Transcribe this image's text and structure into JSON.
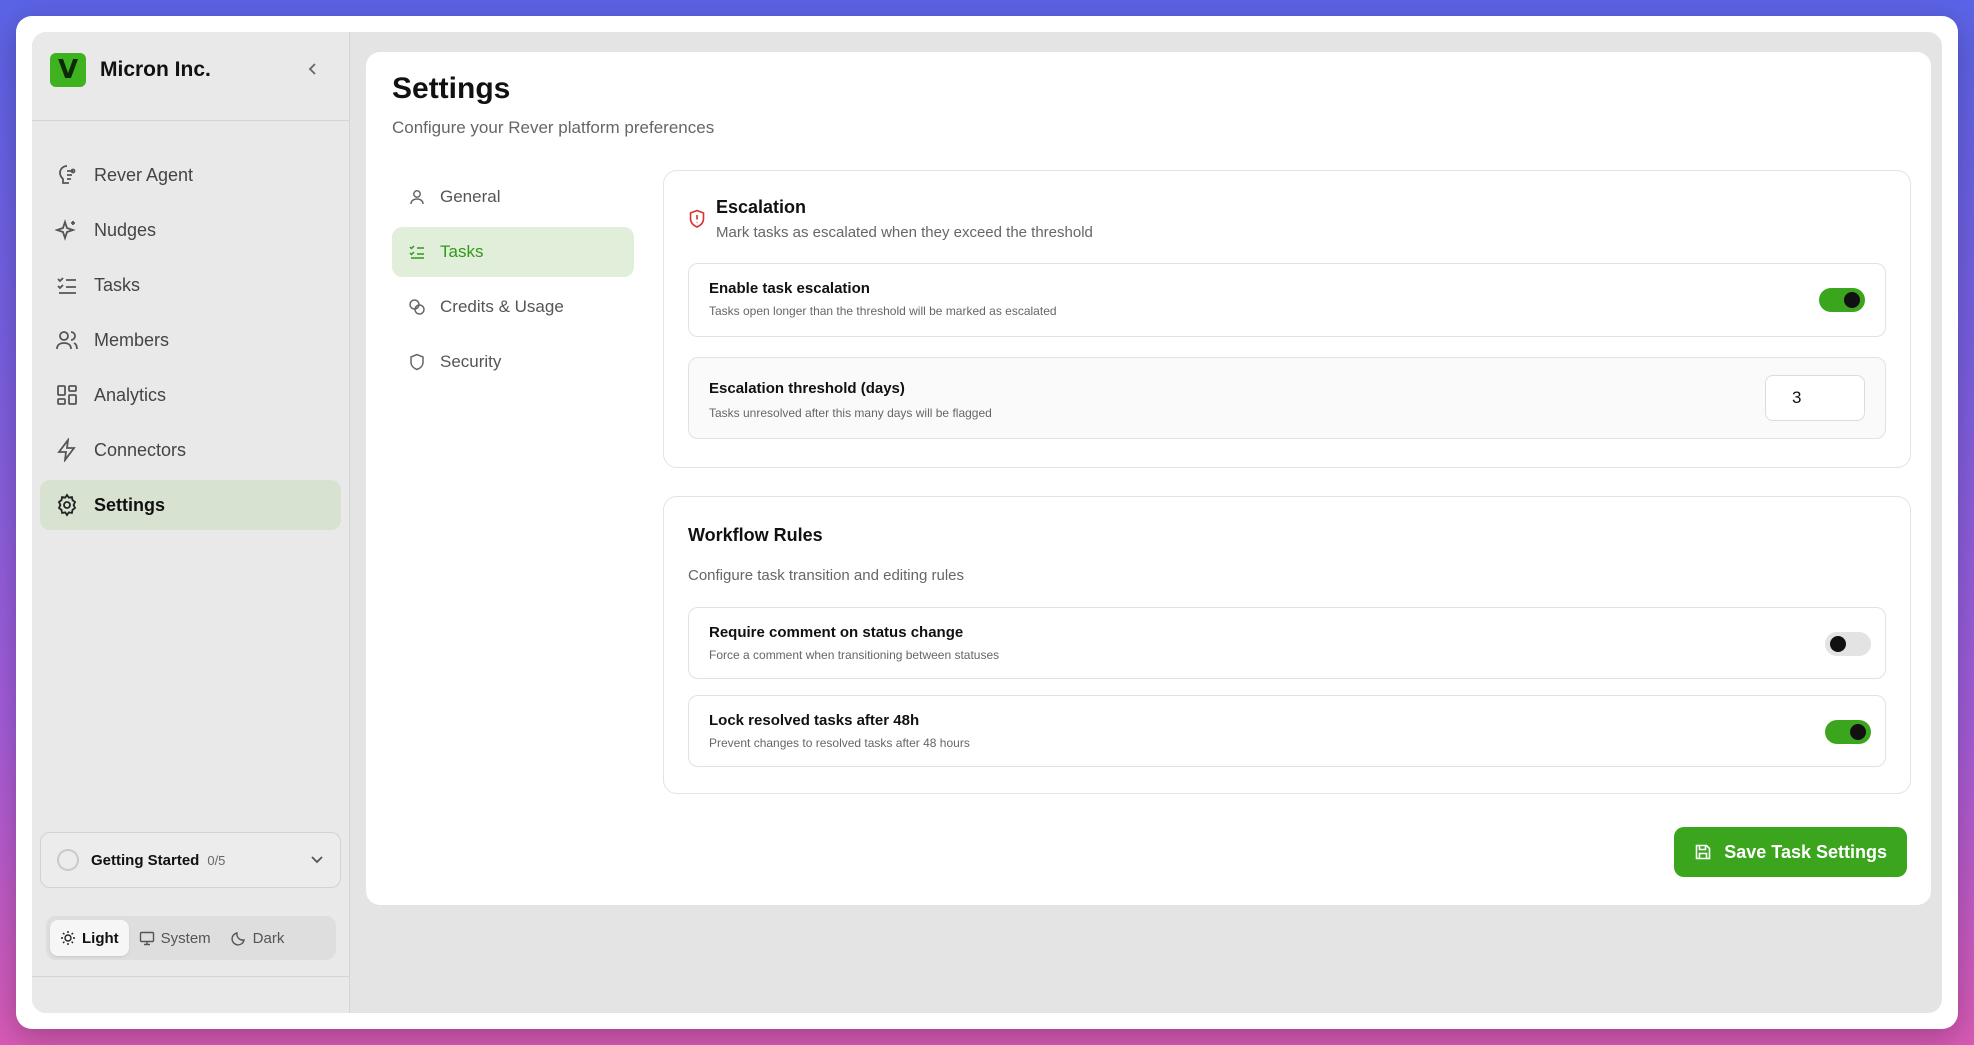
{
  "brand": {
    "logo": "V",
    "name": "Micron Inc.",
    "collapse_icon": "chevron-left-icon"
  },
  "sidebar": {
    "items": [
      {
        "label": "Rever Agent",
        "icon": "agent-icon"
      },
      {
        "label": "Nudges",
        "icon": "sparkles-icon"
      },
      {
        "label": "Tasks",
        "icon": "list-checks-icon"
      },
      {
        "label": "Members",
        "icon": "users-icon"
      },
      {
        "label": "Analytics",
        "icon": "grid-icon"
      },
      {
        "label": "Connectors",
        "icon": "bolt-icon"
      },
      {
        "label": "Settings",
        "icon": "gear-icon",
        "active": true
      }
    ],
    "getting_started": {
      "label": "Getting Started",
      "count": "0/5"
    },
    "theme": {
      "light": "Light",
      "system": "System",
      "dark": "Dark",
      "selected": "Light"
    }
  },
  "page": {
    "title": "Settings",
    "subtitle": "Configure your Rever platform preferences"
  },
  "subnav": {
    "items": [
      {
        "label": "General",
        "icon": "user-icon"
      },
      {
        "label": "Tasks",
        "icon": "list-checks-icon",
        "active": true
      },
      {
        "label": "Credits & Usage",
        "icon": "coins-icon"
      },
      {
        "label": "Security",
        "icon": "shield-icon"
      }
    ]
  },
  "escalation": {
    "title": "Escalation",
    "subtitle": "Mark tasks as escalated when they exceed the threshold",
    "enable": {
      "title": "Enable task escalation",
      "description": "Tasks open longer than the threshold will be marked as escalated",
      "enabled": true
    },
    "threshold": {
      "title": "Escalation threshold (days)",
      "description": "Tasks unresolved after this many days will be flagged",
      "value": "3"
    }
  },
  "workflow": {
    "title": "Workflow Rules",
    "subtitle": "Configure task transition and editing rules",
    "require_comment": {
      "title": "Require comment on status change",
      "description": "Force a comment when transitioning between statuses",
      "enabled": false
    },
    "lock_resolved": {
      "title": "Lock resolved tasks after 48h",
      "description": "Prevent changes to resolved tasks after 48 hours",
      "enabled": true
    }
  },
  "actions": {
    "save_label": "Save Task Settings"
  },
  "colors": {
    "accent": "#3aa51d",
    "active_nav_bg": "#d7e2d1",
    "danger": "#d93030"
  }
}
